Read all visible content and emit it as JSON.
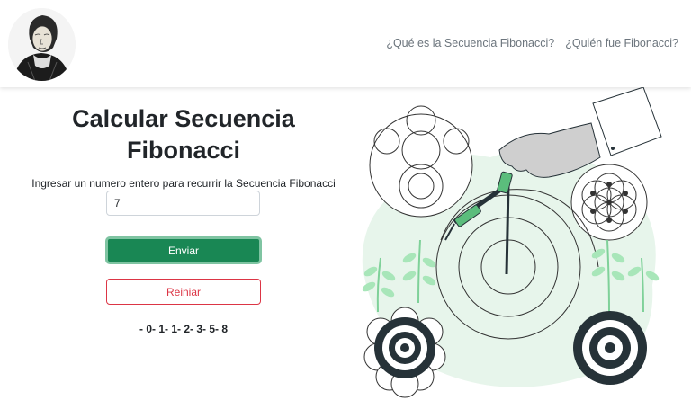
{
  "nav": {
    "links": [
      "¿Qué es la Secuencia Fibonacci?",
      "¿Quién fue Fibonacci?"
    ]
  },
  "main": {
    "title_line1": "Calcular Secuencia",
    "title_line2": "Fibonacci",
    "input_label": "Ingresar un numero entero para recurrir la Secuencia Fibonacci",
    "input_value": "7",
    "submit_label": "Enviar",
    "reset_label": "Reiniar",
    "result": "- 0- 1- 1- 2- 3- 5- 8"
  },
  "colors": {
    "primary": "#198754",
    "danger": "#dc3545",
    "muted": "#6c757d",
    "blob": "#e7f5eb",
    "leaf": "#a8e6b9",
    "accent_green": "#5bbd7c",
    "dark": "#263238"
  },
  "icons": [
    "fibonacci-portrait-logo",
    "compass-illustration"
  ]
}
